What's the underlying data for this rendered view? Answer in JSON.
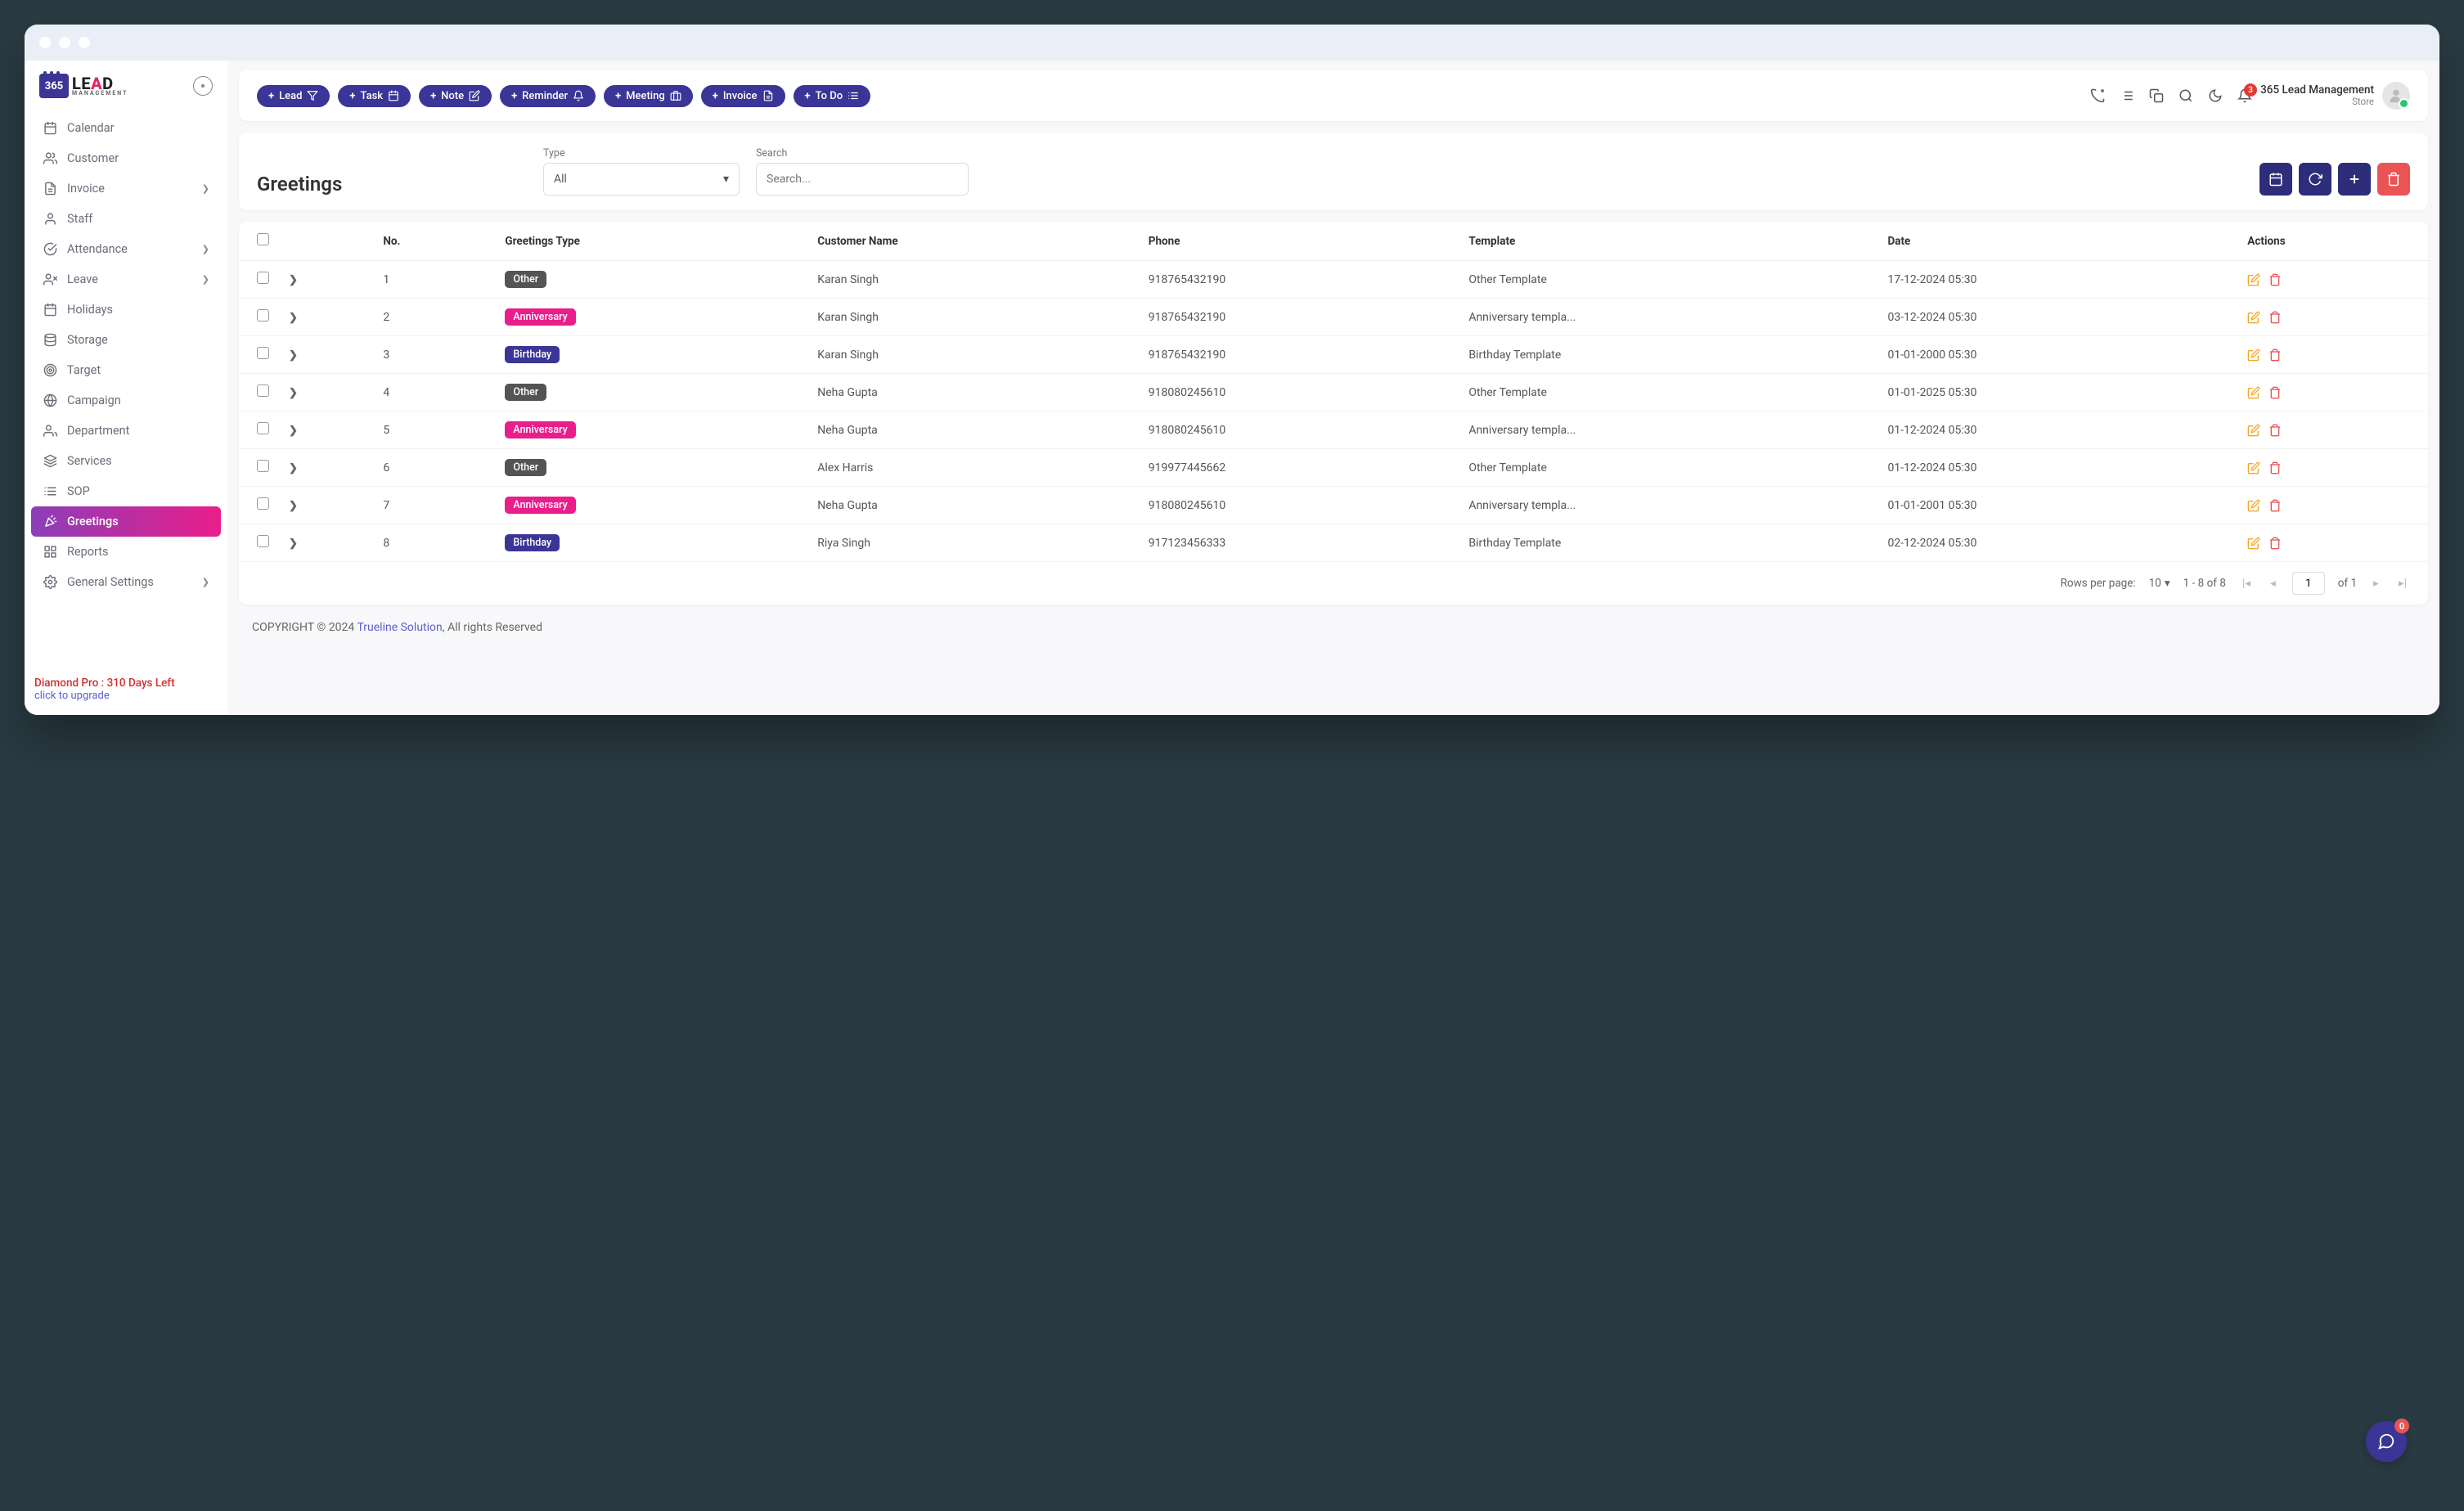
{
  "brand": {
    "cal_text": "365",
    "name": "LEAD",
    "sub": "MANAGEMENT"
  },
  "quick_actions": [
    {
      "label": "Lead",
      "icon": "funnel"
    },
    {
      "label": "Task",
      "icon": "calendar"
    },
    {
      "label": "Note",
      "icon": "note"
    },
    {
      "label": "Reminder",
      "icon": "bell"
    },
    {
      "label": "Meeting",
      "icon": "briefcase"
    },
    {
      "label": "Invoice",
      "icon": "file"
    },
    {
      "label": "To Do",
      "icon": "list"
    }
  ],
  "header": {
    "notification_count": "3",
    "user_name": "365 Lead Management",
    "user_role": "Store"
  },
  "sidebar": {
    "items": [
      {
        "label": "Calendar",
        "icon": "calendar",
        "expand": false
      },
      {
        "label": "Customer",
        "icon": "users",
        "expand": false
      },
      {
        "label": "Invoice",
        "icon": "file",
        "expand": true
      },
      {
        "label": "Staff",
        "icon": "user",
        "expand": false
      },
      {
        "label": "Attendance",
        "icon": "check-circle",
        "expand": true
      },
      {
        "label": "Leave",
        "icon": "user-x",
        "expand": true
      },
      {
        "label": "Holidays",
        "icon": "calendar",
        "expand": false
      },
      {
        "label": "Storage",
        "icon": "disk",
        "expand": false
      },
      {
        "label": "Target",
        "icon": "target",
        "expand": false
      },
      {
        "label": "Campaign",
        "icon": "globe",
        "expand": false
      },
      {
        "label": "Department",
        "icon": "user-group",
        "expand": false
      },
      {
        "label": "Services",
        "icon": "layers",
        "expand": false
      },
      {
        "label": "SOP",
        "icon": "list",
        "expand": false
      },
      {
        "label": "Greetings",
        "icon": "confetti",
        "expand": false,
        "active": true
      },
      {
        "label": "Reports",
        "icon": "grid",
        "expand": false
      },
      {
        "label": "General Settings",
        "icon": "gear",
        "expand": true
      }
    ],
    "plan": "Diamond Pro : 310 Days Left",
    "upgrade": "click to upgrade"
  },
  "page": {
    "title": "Greetings",
    "filters": {
      "type_label": "Type",
      "type_value": "All",
      "search_label": "Search",
      "search_placeholder": "Search..."
    }
  },
  "table": {
    "columns": [
      "No.",
      "Greetings Type",
      "Customer Name",
      "Phone",
      "Template",
      "Date",
      "Actions"
    ],
    "rows": [
      {
        "no": "1",
        "type": "Other",
        "type_class": "other",
        "name": "Karan Singh",
        "phone": "918765432190",
        "template": "Other Template",
        "date": "17-12-2024 05:30"
      },
      {
        "no": "2",
        "type": "Anniversary",
        "type_class": "anniversary",
        "name": "Karan Singh",
        "phone": "918765432190",
        "template": "Anniversary templa...",
        "date": "03-12-2024 05:30"
      },
      {
        "no": "3",
        "type": "Birthday",
        "type_class": "birthday",
        "name": "Karan Singh",
        "phone": "918765432190",
        "template": "Birthday Template",
        "date": "01-01-2000 05:30"
      },
      {
        "no": "4",
        "type": "Other",
        "type_class": "other",
        "name": "Neha Gupta",
        "phone": "918080245610",
        "template": "Other Template",
        "date": "01-01-2025 05:30"
      },
      {
        "no": "5",
        "type": "Anniversary",
        "type_class": "anniversary",
        "name": "Neha Gupta",
        "phone": "918080245610",
        "template": "Anniversary templa...",
        "date": "01-12-2024 05:30"
      },
      {
        "no": "6",
        "type": "Other",
        "type_class": "other",
        "name": "Alex Harris",
        "phone": "919977445662",
        "template": "Other Template",
        "date": "01-12-2024 05:30"
      },
      {
        "no": "7",
        "type": "Anniversary",
        "type_class": "anniversary",
        "name": "Neha Gupta",
        "phone": "918080245610",
        "template": "Anniversary templa...",
        "date": "01-01-2001 05:30"
      },
      {
        "no": "8",
        "type": "Birthday",
        "type_class": "birthday",
        "name": "Riya Singh",
        "phone": "917123456333",
        "template": "Birthday Template",
        "date": "02-12-2024 05:30"
      }
    ]
  },
  "pager": {
    "rows_label": "Rows per page:",
    "rows_value": "10",
    "range": "1 - 8 of 8",
    "page": "1",
    "of_label": "of 1"
  },
  "footer": {
    "copyright": "COPYRIGHT © 2024 ",
    "link": "Trueline Solution",
    "rest": ", All rights Reserved"
  },
  "chat_count": "0"
}
